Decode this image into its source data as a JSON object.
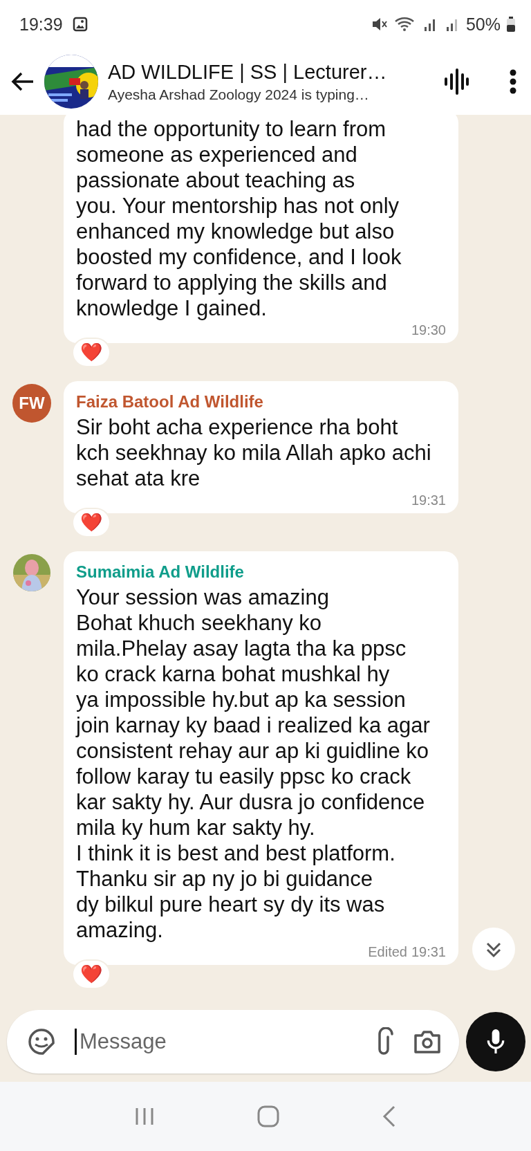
{
  "status_bar": {
    "time": "19:39",
    "battery": "50%"
  },
  "header": {
    "title": "AD WILDLIFE | SS | Lecturer…",
    "subtitle": "Ayesha Arshad Zoology 2024 is typing…"
  },
  "messages": [
    {
      "kind": "continued",
      "text": "had the opportunity to learn from\nsomeone as experienced and\npassionate about teaching as\nyou. Your mentorship has not only\nenhanced my knowledge but also\nboosted my confidence, and I look\nforward to applying the skills and\nknowledge I gained.",
      "time": "19:30",
      "reaction": "❤️"
    },
    {
      "kind": "initials",
      "initials": "FW",
      "color": "#c0562f",
      "sender": "Faiza Batool Ad Wildlife",
      "text": "Sir boht acha experience rha boht\nkch seekhnay ko mila Allah apko achi\nsehat ata kre",
      "time": "19:31",
      "reaction": "❤️"
    },
    {
      "sender": "Sumaimia Ad Wildlife",
      "color": "#0f9d8a",
      "text": "Your session was amazing\nBohat khuch seekhany ko\nmila.Phelay asay lagta tha ka ppsc\nko crack karna bohat mushkal hy\nya impossible hy.but ap ka session\njoin karnay ky baad i realized ka agar\nconsistent rehay aur ap ki guidline ko\nfollow karay tu easily ppsc ko crack\nkar sakty hy. Aur dusra jo confidence\nmila ky hum kar sakty hy.\nI think it is best and best platform.\nThanku sir ap ny jo bi guidance\ndy bilkul pure heart sy dy its was\namazing.",
      "edited_label": "Edited",
      "time": "19:31",
      "reaction": "❤️"
    }
  ],
  "composer": {
    "placeholder": "Message"
  }
}
